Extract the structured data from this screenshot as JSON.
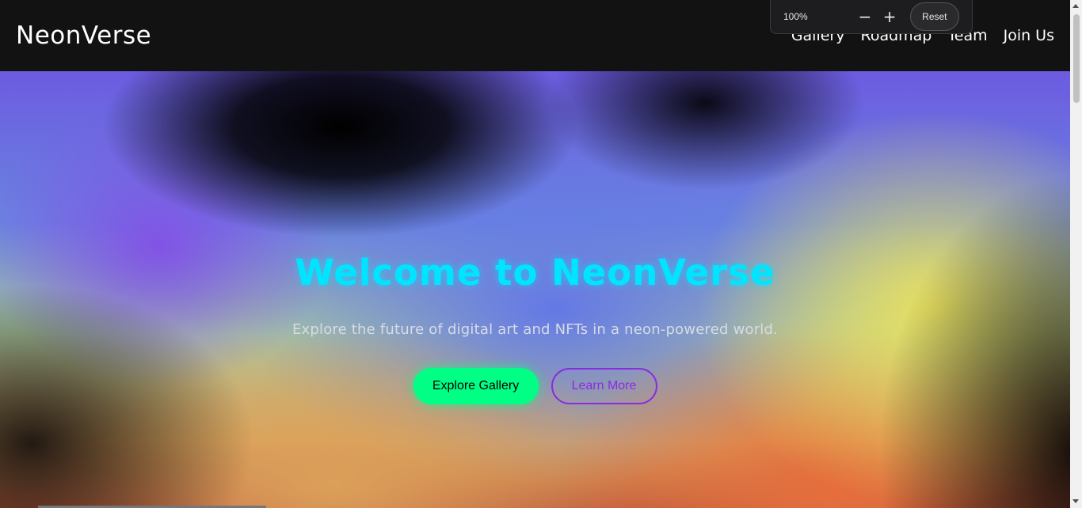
{
  "nav": {
    "logo": "NeonVerse",
    "links": [
      "Gallery",
      "Roadmap",
      "Team",
      "Join Us"
    ]
  },
  "hero": {
    "title": "Welcome to NeonVerse",
    "subtitle": "Explore the future of digital art and NFTs in a neon-powered world.",
    "primary_cta": "Explore Gallery",
    "secondary_cta": "Learn More"
  },
  "zoom": {
    "level": "100%",
    "minus": "−",
    "plus": "+",
    "reset": "Reset"
  },
  "colors": {
    "accent_cyan": "#00e5ff",
    "cta_green": "#00ff85",
    "cta_purple": "#8a2be2",
    "nav_bg": "#121212"
  },
  "icons": {
    "zoom_out": "minus-icon",
    "zoom_in": "plus-icon"
  }
}
